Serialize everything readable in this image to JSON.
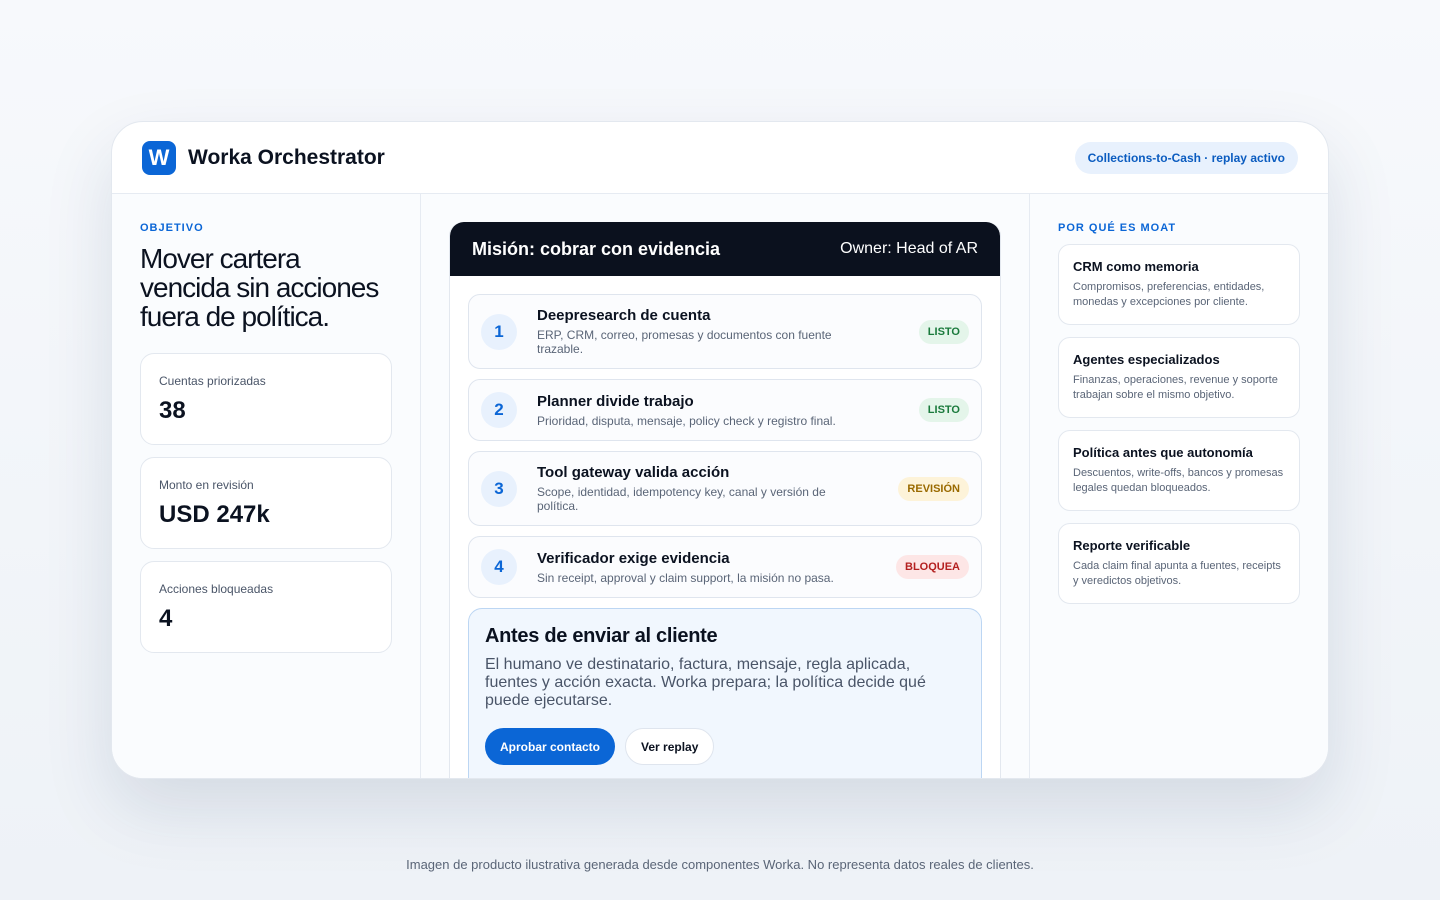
{
  "app": {
    "logo_letter": "W",
    "title": "Worka Orchestrator",
    "status": "Collections-to-Cash · replay activo"
  },
  "objective": {
    "eyebrow": "OBJETIVO",
    "headline": "Mover cartera vencida sin acciones fuera de política.",
    "metrics": [
      {
        "label": "Cuentas priorizadas",
        "value": "38"
      },
      {
        "label": "Monto en revisión",
        "value": "USD 247k"
      },
      {
        "label": "Acciones bloqueadas",
        "value": "4"
      }
    ]
  },
  "mission": {
    "title": "Misión: cobrar con evidencia",
    "owner": "Owner: Head of AR",
    "steps": [
      {
        "num": "1",
        "title": "Deepresearch de cuenta",
        "desc": "ERP, CRM, correo, promesas y documentos con fuente trazable.",
        "badge": "LISTO",
        "status": "ok"
      },
      {
        "num": "2",
        "title": "Planner divide trabajo",
        "desc": "Prioridad, disputa, mensaje, policy check y registro final.",
        "badge": "LISTO",
        "status": "ok"
      },
      {
        "num": "3",
        "title": "Tool gateway valida acción",
        "desc": "Scope, identidad, idempotency key, canal y versión de política.",
        "badge": "REVISIÓN",
        "status": "warn"
      },
      {
        "num": "4",
        "title": "Verificador exige evidencia",
        "desc": "Sin receipt, approval y claim support, la misión no pasa.",
        "badge": "BLOQUEA",
        "status": "block"
      }
    ],
    "send": {
      "title": "Antes de enviar al cliente",
      "text": "El humano ve destinatario, factura, mensaje, regla aplicada, fuentes y acción exacta. Worka prepara; la política decide qué puede ejecutarse.",
      "approve_label": "Aprobar contacto",
      "replay_label": "Ver replay"
    }
  },
  "moat": {
    "eyebrow": "POR QUÉ ES MOAT",
    "cards": [
      {
        "title": "CRM como memoria",
        "desc": "Compromisos, preferencias, entidades, monedas y excepciones por cliente."
      },
      {
        "title": "Agentes especializados",
        "desc": "Finanzas, operaciones, revenue y soporte trabajan sobre el mismo objetivo."
      },
      {
        "title": "Política antes que autonomía",
        "desc": "Descuentos, write-offs, bancos y promesas legales quedan bloqueados."
      },
      {
        "title": "Reporte verificable",
        "desc": "Cada claim final apunta a fuentes, receipts y veredictos objetivos."
      }
    ]
  },
  "footer": {
    "note": "Imagen de producto ilustrativa generada desde componentes Worka. No representa datos reales de clientes."
  },
  "colors": {
    "accent": "#0b66d6",
    "mission_header": "#0b111e",
    "ok": "#1a7a3c",
    "warn": "#9a6a00",
    "block": "#b42020"
  }
}
